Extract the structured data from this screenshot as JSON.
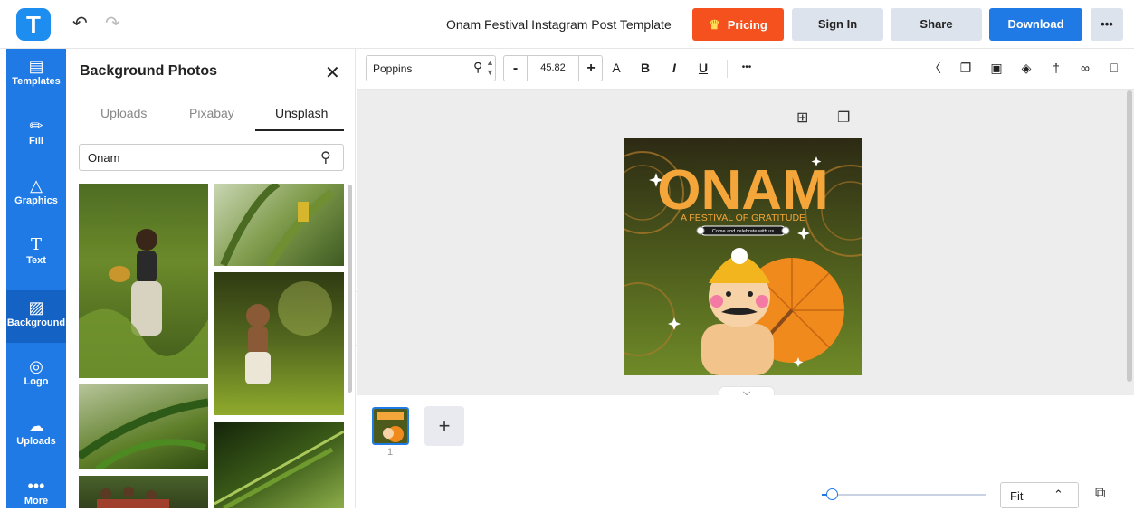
{
  "app": {
    "logo_letter": "T"
  },
  "header": {
    "title": "Onam Festival Instagram Post Template",
    "undo_icon": "undo-icon",
    "redo_icon": "redo-icon",
    "pricing_label": "Pricing",
    "signin_label": "Sign In",
    "share_label": "Share",
    "download_label": "Download",
    "more_label": "•••",
    "accent_color": "#f4511e",
    "primary_color": "#1f7ae6"
  },
  "rail": {
    "items": [
      {
        "label": "Templates",
        "icon": "▤"
      },
      {
        "label": "Fill",
        "icon": "✏"
      },
      {
        "label": "Graphics",
        "icon": "△"
      },
      {
        "label": "Text",
        "icon": "T"
      },
      {
        "label": "Background",
        "icon": "▨"
      },
      {
        "label": "Logo",
        "icon": "◎"
      },
      {
        "label": "Uploads",
        "icon": "☁"
      },
      {
        "label": "More",
        "icon": "•••"
      }
    ],
    "active": "Background"
  },
  "panel": {
    "title": "Background Photos",
    "tabs": [
      "Uploads",
      "Pixabay",
      "Unsplash"
    ],
    "active_tab": "Unsplash",
    "search_value": "Onam"
  },
  "toolbar": {
    "font_family_value": "Poppins",
    "font_size_value": "45.82",
    "minus_label": "-",
    "plus_label": "+",
    "text_color_label": "A",
    "bold_label": "B",
    "italic_label": "I",
    "underline_label": "U",
    "more_label": "•••"
  },
  "design": {
    "title": "ONAM",
    "subtitle": "A FESTIVAL OF GRATITUDE",
    "tagline": "Come and celebrate with us"
  },
  "pages": {
    "current_page": "1",
    "add_label": "+"
  },
  "zoom": {
    "value": "Fit"
  }
}
